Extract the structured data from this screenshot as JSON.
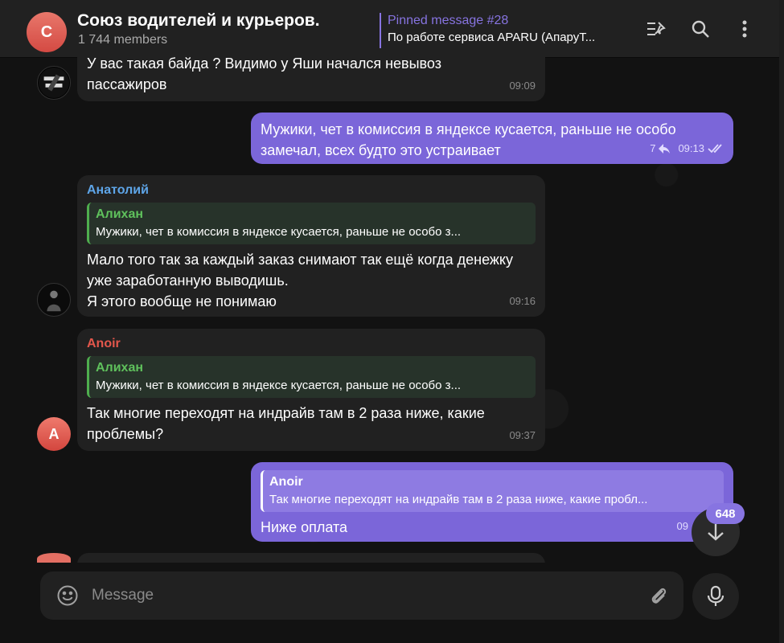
{
  "header": {
    "avatar_letter": "С",
    "title": "Союз водителей и курьеров.",
    "members": "1 744 members",
    "pinned_title": "Pinned message #28",
    "pinned_text": "По работе сервиса APARU (АпаруТ..."
  },
  "messages": [
    {
      "text": "У вас такая байда ? Видимо у Яши начался невывоз пассажиров",
      "time": "09:09"
    },
    {
      "text": "Мужики, чет в комиссия в яндексе кусается, раньше не особо замечал, всех будто это устраивает",
      "replies": "7",
      "time": "09:13"
    },
    {
      "sender": "Анатолий",
      "reply_name": "Алихан",
      "reply_text": "Мужики, чет в комиссия в яндексе кусается, раньше не особо з...",
      "text": "Мало того так за каждый заказ снимают так ещё когда денежку уже заработанную выводишь.\nЯ этого вообще не понимаю",
      "time": "09:16"
    },
    {
      "sender": "Anoir",
      "avatar_letter": "A",
      "reply_name": "Алихан",
      "reply_text": "Мужики, чет в комиссия в яндексе кусается, раньше не особо з...",
      "text": "Так многие переходят на индрайв там в 2 раза ниже, какие проблемы?",
      "time": "09:37"
    },
    {
      "reply_name": "Anoir",
      "reply_text": "Так многие переходят на индрайв там в 2 раза ниже, какие пробл...",
      "text": "Ниже оплата",
      "time": "09"
    }
  ],
  "scroll": {
    "unread_count": "648"
  },
  "composer": {
    "placeholder": "Message"
  },
  "colors": {
    "accent": "#8774e1",
    "outgoing": "#7b66d9",
    "anoir": "#e4574c",
    "anatoly": "#5ea5e8"
  }
}
